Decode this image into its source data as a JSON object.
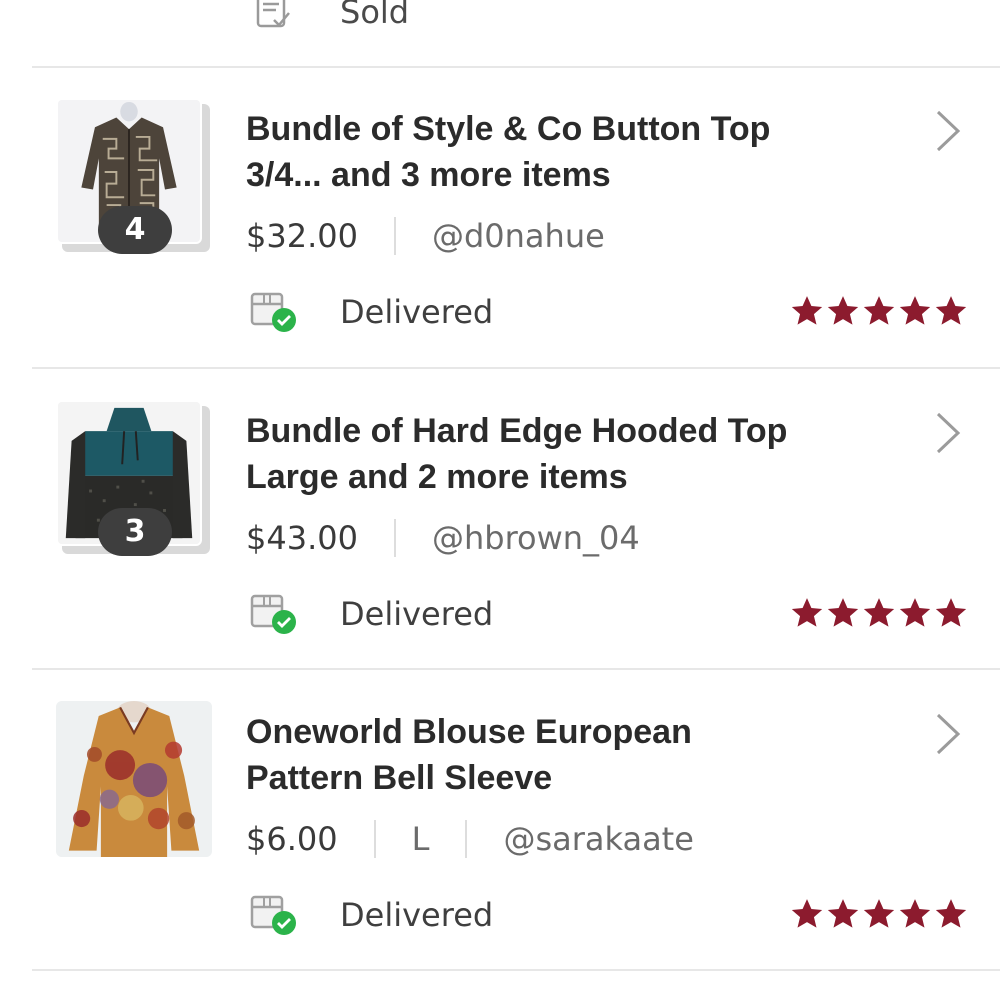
{
  "top_status": {
    "label": "Sold",
    "icon": "sold-receipt-icon"
  },
  "colors": {
    "star": "#8c1b2e",
    "check": "#2bb34a",
    "badge_bg": "#3e3e3e",
    "divider": "#e7e7e7"
  },
  "orders": [
    {
      "title_line1": "Bundle of Style & Co Button Top",
      "title_line2": "3/4... and 3 more items",
      "price": "$32.00",
      "size": "",
      "seller": "@d0nahue",
      "bundle_count": "4",
      "status": "Delivered",
      "rating": 5,
      "thumbnail": "patterned-button-top"
    },
    {
      "title_line1": "Bundle of Hard Edge Hooded Top",
      "title_line2": "Large and 2 more items",
      "price": "$43.00",
      "size": "",
      "seller": "@hbrown_04",
      "bundle_count": "3",
      "status": "Delivered",
      "rating": 5,
      "thumbnail": "teal-black-hooded-top"
    },
    {
      "title_line1": "Oneworld Blouse European",
      "title_line2": "Pattern Bell Sleeve",
      "price": "$6.00",
      "size": "L",
      "seller": "@sarakaate",
      "bundle_count": "",
      "status": "Delivered",
      "rating": 5,
      "thumbnail": "floral-bell-sleeve-blouse"
    }
  ]
}
